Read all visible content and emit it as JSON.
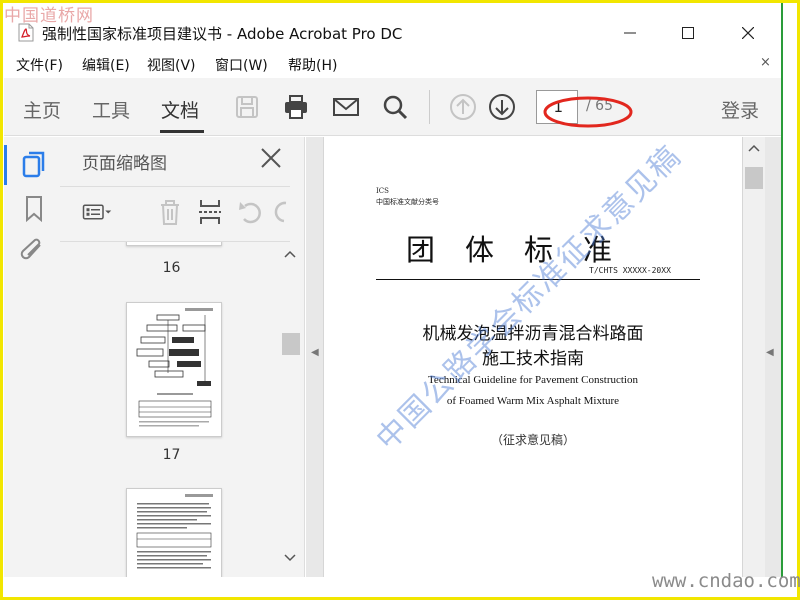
{
  "watermark_top": "中国道桥网",
  "watermark_bottom": "www.cndao.com",
  "window": {
    "title": "强制性国家标准项目建议书 - Adobe Acrobat Pro DC",
    "min_label": "—",
    "max_label": "☐",
    "close_label": "✕"
  },
  "menu": {
    "items": [
      "文件(F)",
      "编辑(E)",
      "视图(V)",
      "窗口(W)",
      "帮助(H)"
    ],
    "close_label": "×"
  },
  "toolbar": {
    "tabs": [
      "主页",
      "工具",
      "文档"
    ],
    "active_tab": "文档",
    "page_current": "1",
    "page_total": "/ 65",
    "signin_label": "登录",
    "icons": [
      "save-icon",
      "print-icon",
      "email-icon",
      "search-icon",
      "page-up-icon",
      "page-down-icon"
    ]
  },
  "left_rail": {
    "icons": [
      "page-thumbnails-icon",
      "bookmark-icon",
      "attachment-icon"
    ],
    "accent": "#2b7de9"
  },
  "thumb_panel": {
    "title": "页面缩略图",
    "pages": [
      "16",
      "17"
    ]
  },
  "document": {
    "ics": "ICS",
    "classification": "中国标准文献分类号",
    "main_title": "团体标准",
    "std_code": "T/CHTS XXXXX-20XX",
    "cn_title_line1": "机械发泡温拌沥青混合料路面",
    "cn_title_line2": "施工技术指南",
    "en_title_line1": "Technical Guideline for Pavement Construction",
    "en_title_line2": "of Foamed Warm Mix Asphalt Mixture",
    "draft_label": "（征求意见稿）",
    "watermark": "中国公路学会标准征求意见稿"
  }
}
